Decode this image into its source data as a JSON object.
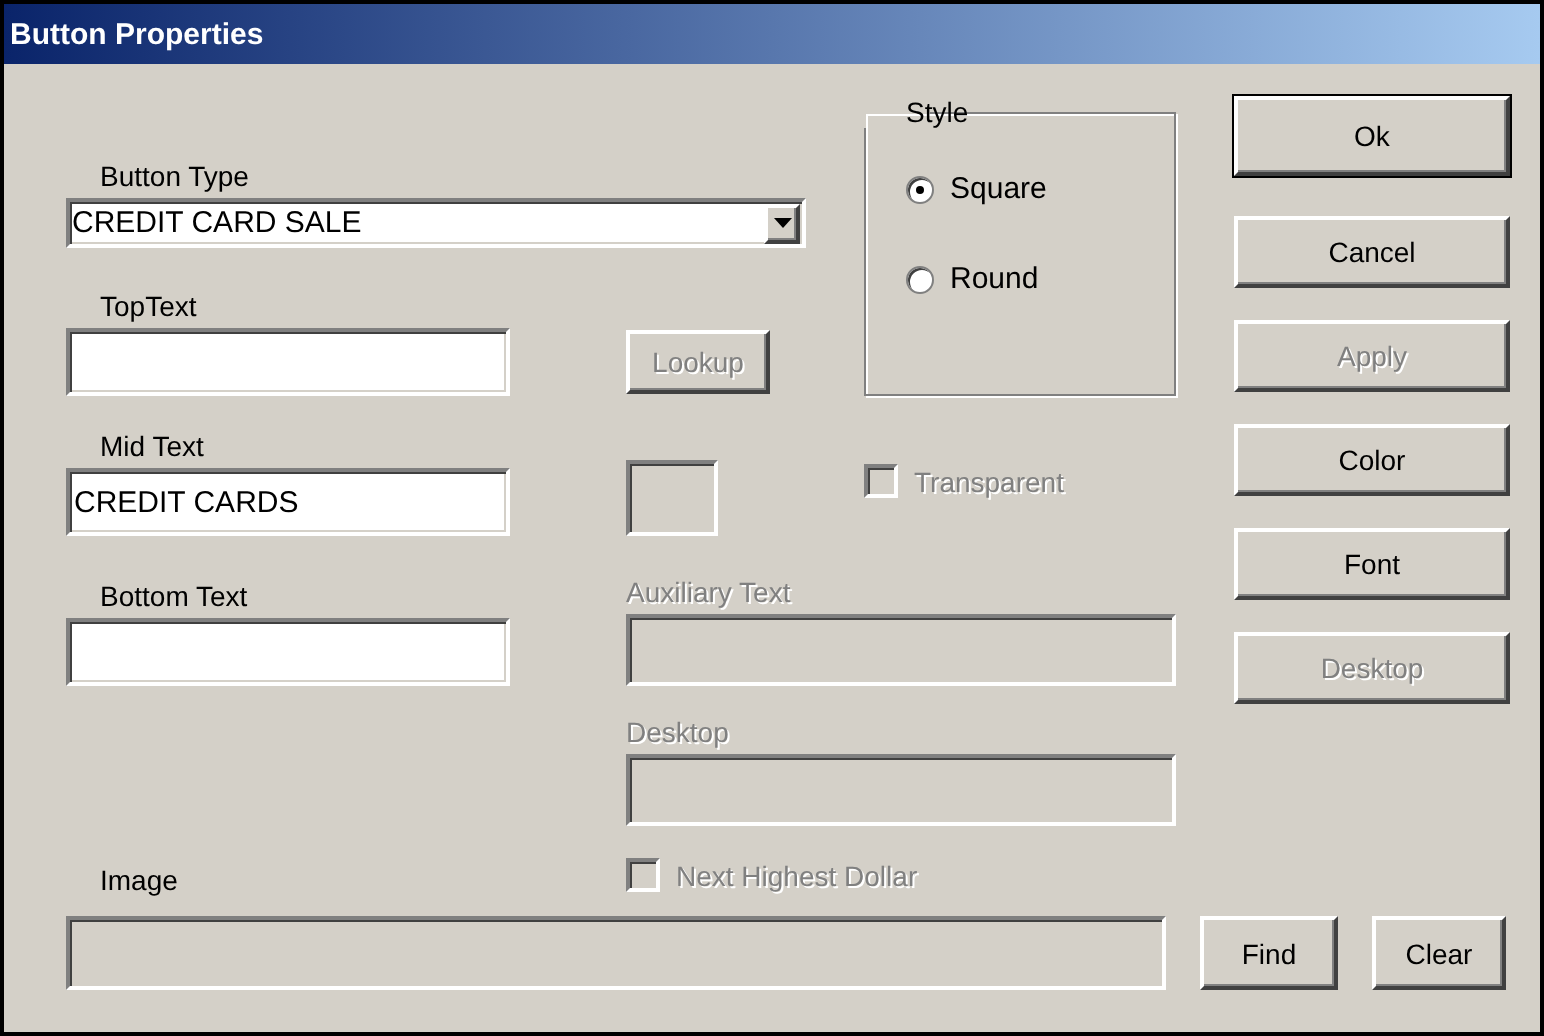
{
  "window": {
    "title": "Button Properties"
  },
  "button_type": {
    "label": "Button Type",
    "value": "CREDIT CARD SALE"
  },
  "text_fields": [
    {
      "label": "TopText",
      "disabled": false
    },
    {
      "label": "Mid Text",
      "value": "CREDIT CARDS",
      "disabled": false
    },
    {
      "label": "Bottom Text",
      "disabled": false
    }
  ],
  "lookup_button": {
    "label": "Lookup",
    "disabled": true
  },
  "style": {
    "label": "Style",
    "options": [
      {
        "label": "Square",
        "selected": true
      },
      {
        "label": "Round",
        "selected": false
      }
    ]
  },
  "transparent": {
    "label": "Transparent",
    "checked": false,
    "disabled": true
  },
  "middle_fields": [
    {
      "label": "Auxiliary Text",
      "disabled": true
    },
    {
      "label": "Desktop",
      "disabled": true
    }
  ],
  "next_highest_dollar": {
    "label": "Next Highest Dollar",
    "checked": false,
    "disabled": true
  },
  "side_buttons": [
    {
      "label": "Ok",
      "default": true,
      "disabled": false
    },
    {
      "label": "Cancel",
      "default": false,
      "disabled": false
    },
    {
      "label": "Apply",
      "default": false,
      "disabled": true
    },
    {
      "label": "Color",
      "default": false,
      "disabled": false
    },
    {
      "label": "Font",
      "default": false,
      "disabled": false
    },
    {
      "label": "Desktop",
      "default": false,
      "disabled": true
    }
  ],
  "image": {
    "label": "Image",
    "disabled": true
  },
  "image_buttons": [
    {
      "label": "Find",
      "disabled": false
    },
    {
      "label": "Clear",
      "disabled": false
    }
  ]
}
